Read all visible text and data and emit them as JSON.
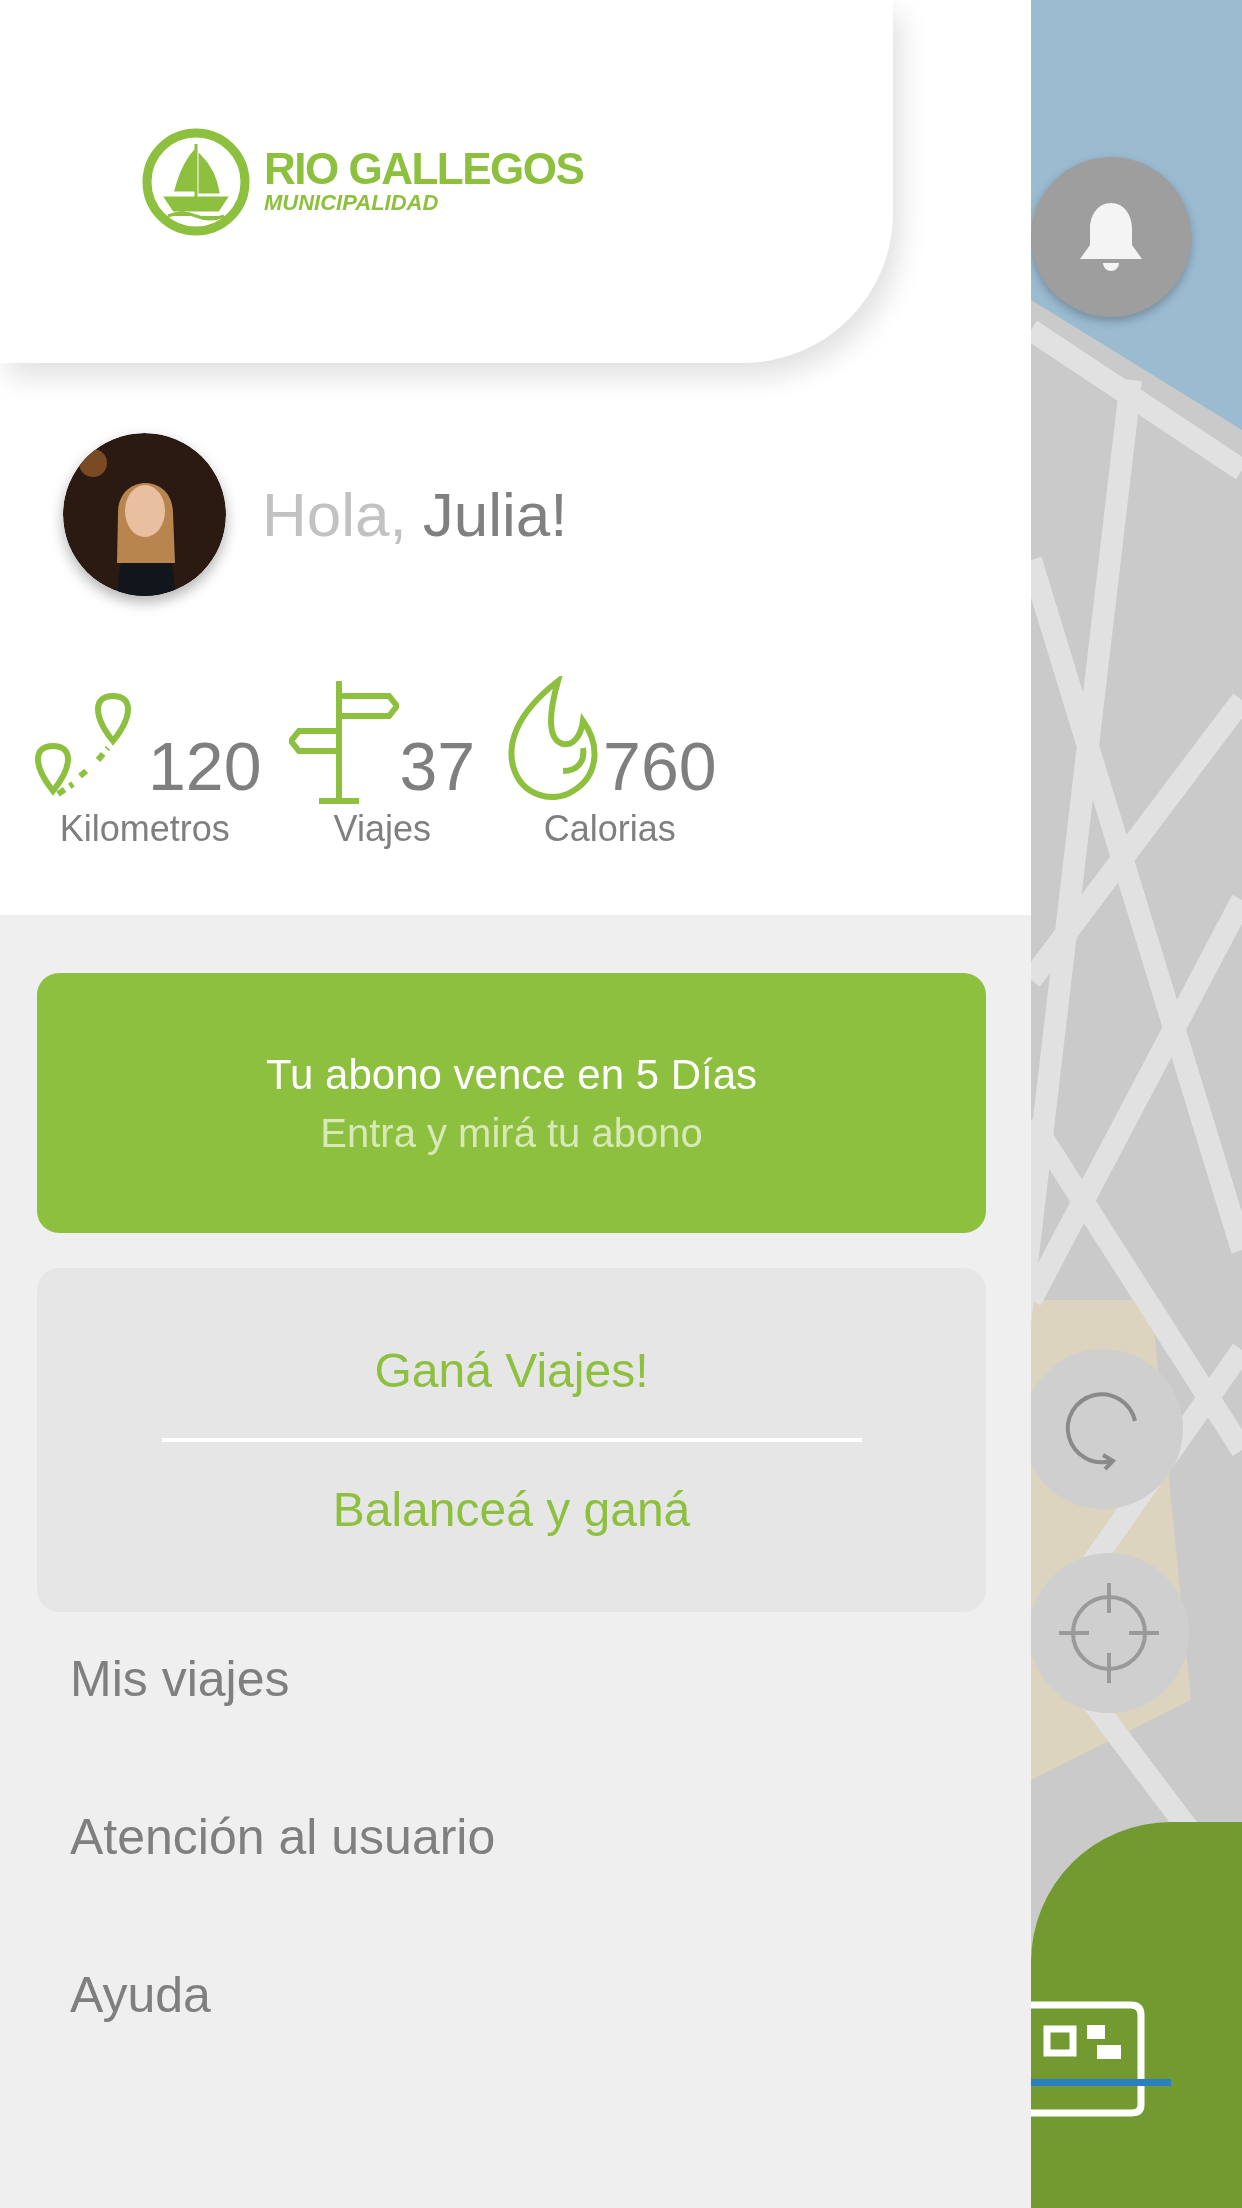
{
  "logo": {
    "title": "RIO GALLEGOS",
    "subtitle": "MUNICIPALIDAD"
  },
  "profile": {
    "greeting": "Hola,",
    "name": "Julia!"
  },
  "stats": [
    {
      "kind": "distance",
      "value": "120",
      "label": "Kilometros"
    },
    {
      "kind": "trips",
      "value": "37",
      "label": "Viajes"
    },
    {
      "kind": "calories",
      "value": "760",
      "label": "Calorias"
    }
  ],
  "subscription_banner": {
    "title": "Tu abono vence en 5 Días",
    "subtitle": "Entra y mirá tu abono"
  },
  "promos": [
    "Ganá Viajes!",
    "Balanceá y ganá"
  ],
  "menu": [
    "Mis viajes",
    "Atención al usuario",
    "Ayuda"
  ],
  "map": {
    "kind": "picture"
  }
}
